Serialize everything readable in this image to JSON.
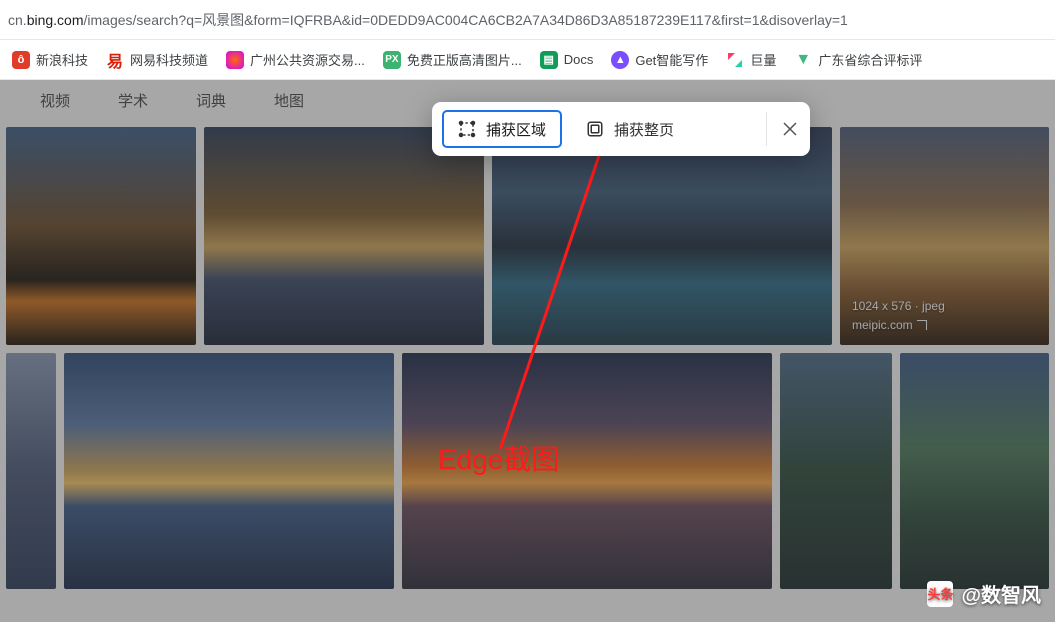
{
  "url": {
    "prefix": "cn.",
    "host": "bing.com",
    "path": "/images/search?q=风景图&form=IQFRBA&id=0DEDD9AC004CA6CB2A7A34D86D3A85187239E117&first=1&disoverlay=1"
  },
  "bookmarks": [
    {
      "label": "新浪科技",
      "cls": "sina",
      "glyph": "ô"
    },
    {
      "label": "网易科技频道",
      "cls": "netease",
      "glyph": "易"
    },
    {
      "label": "广州公共资源交易...",
      "cls": "gz",
      "glyph": ""
    },
    {
      "label": "免费正版高清图片...",
      "cls": "px",
      "glyph": "PX"
    },
    {
      "label": "Docs",
      "cls": "docs",
      "glyph": "▤"
    },
    {
      "label": "Get智能写作",
      "cls": "get",
      "glyph": "▲"
    },
    {
      "label": "巨量",
      "cls": "ju",
      "glyph": ""
    },
    {
      "label": "广东省综合评标评",
      "cls": "vue",
      "glyph": "▼"
    }
  ],
  "tabs": [
    "视频",
    "学术",
    "词典",
    "地图"
  ],
  "capture": {
    "area": "捕获区域",
    "full": "捕获整页"
  },
  "thumb_info": {
    "dims": "1024 x 576 · jpeg",
    "source": "meipic.com"
  },
  "annotation": "Edge截图",
  "watermark": {
    "logo": "头条",
    "handle": "@数智风"
  }
}
